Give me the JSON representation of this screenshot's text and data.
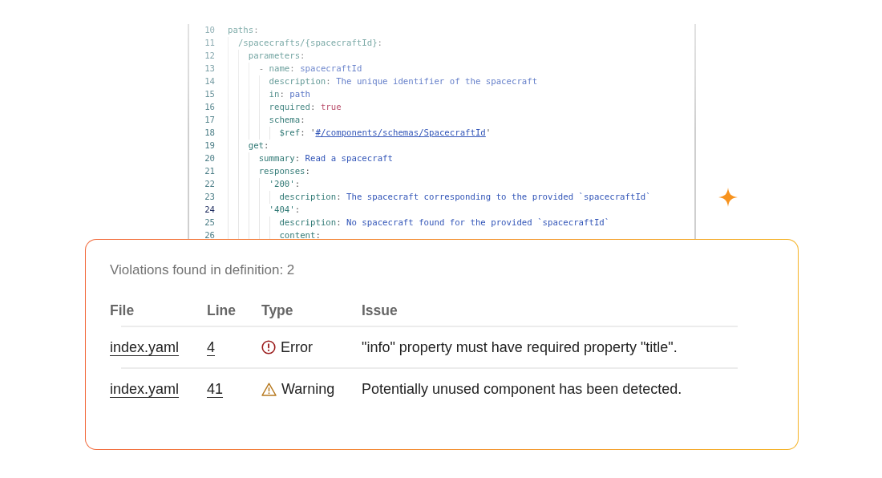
{
  "editor": {
    "lines": [
      {
        "number": "10",
        "selected": false,
        "parts": [
          {
            "kind": "key",
            "text": "paths"
          },
          {
            "kind": "punct",
            "text": ":"
          }
        ],
        "children": [
          {
            "number": "11",
            "selected": false,
            "parts": [
              {
                "kind": "key",
                "text": "/spacecrafts/{spacecraftId}"
              },
              {
                "kind": "punct",
                "text": ":"
              }
            ],
            "children": [
              {
                "number": "12",
                "selected": false,
                "parts": [
                  {
                    "kind": "key",
                    "text": "parameters"
                  },
                  {
                    "kind": "punct",
                    "text": ":"
                  }
                ],
                "children": [
                  {
                    "number": "13",
                    "selected": false,
                    "parts": [
                      {
                        "kind": "punct",
                        "text": "- "
                      },
                      {
                        "kind": "key",
                        "text": "name"
                      },
                      {
                        "kind": "punct",
                        "text": ": "
                      },
                      {
                        "kind": "value",
                        "text": "spacecraftId"
                      }
                    ],
                    "children": [
                      {
                        "number": "14",
                        "selected": false,
                        "parts": [
                          {
                            "kind": "key",
                            "text": "description"
                          },
                          {
                            "kind": "punct",
                            "text": ": "
                          },
                          {
                            "kind": "value",
                            "text": "The unique identifier of the spacecraft"
                          }
                        ]
                      },
                      {
                        "number": "15",
                        "selected": false,
                        "parts": [
                          {
                            "kind": "key",
                            "text": "in"
                          },
                          {
                            "kind": "punct",
                            "text": ": "
                          },
                          {
                            "kind": "value",
                            "text": "path"
                          }
                        ]
                      },
                      {
                        "number": "16",
                        "selected": false,
                        "parts": [
                          {
                            "kind": "key",
                            "text": "required"
                          },
                          {
                            "kind": "punct",
                            "text": ": "
                          },
                          {
                            "kind": "bool",
                            "text": "true"
                          }
                        ]
                      },
                      {
                        "number": "17",
                        "selected": false,
                        "parts": [
                          {
                            "kind": "key",
                            "text": "schema"
                          },
                          {
                            "kind": "punct",
                            "text": ":"
                          }
                        ],
                        "children": [
                          {
                            "number": "18",
                            "selected": false,
                            "parts": [
                              {
                                "kind": "key",
                                "text": "$ref"
                              },
                              {
                                "kind": "punct",
                                "text": ": '"
                              },
                              {
                                "kind": "link",
                                "text": "#/components/schemas/SpacecraftId"
                              },
                              {
                                "kind": "punct",
                                "text": "'"
                              }
                            ]
                          }
                        ]
                      }
                    ]
                  }
                ]
              },
              {
                "number": "19",
                "selected": false,
                "parts": [
                  {
                    "kind": "key",
                    "text": "get"
                  },
                  {
                    "kind": "punct",
                    "text": ":"
                  }
                ],
                "children": [
                  {
                    "number": "20",
                    "selected": false,
                    "parts": [
                      {
                        "kind": "key",
                        "text": "summary"
                      },
                      {
                        "kind": "punct",
                        "text": ": "
                      },
                      {
                        "kind": "value",
                        "text": "Read a spacecraft"
                      }
                    ]
                  },
                  {
                    "number": "21",
                    "selected": false,
                    "parts": [
                      {
                        "kind": "key",
                        "text": "responses"
                      },
                      {
                        "kind": "punct",
                        "text": ":"
                      }
                    ],
                    "children": [
                      {
                        "number": "22",
                        "selected": false,
                        "parts": [
                          {
                            "kind": "key",
                            "text": "'200'"
                          },
                          {
                            "kind": "punct",
                            "text": ":"
                          }
                        ],
                        "children": [
                          {
                            "number": "23",
                            "selected": false,
                            "parts": [
                              {
                                "kind": "key",
                                "text": "description"
                              },
                              {
                                "kind": "punct",
                                "text": ": "
                              },
                              {
                                "kind": "value",
                                "text": "The spacecraft corresponding to the provided `spacecraftId`"
                              }
                            ]
                          }
                        ]
                      },
                      {
                        "number": "24",
                        "selected": true,
                        "parts": [
                          {
                            "kind": "key",
                            "text": "'404'"
                          },
                          {
                            "kind": "punct",
                            "text": ":"
                          }
                        ],
                        "children": [
                          {
                            "number": "25",
                            "selected": false,
                            "parts": [
                              {
                                "kind": "key",
                                "text": "description"
                              },
                              {
                                "kind": "punct",
                                "text": ": "
                              },
                              {
                                "kind": "value",
                                "text": "No spacecraft found for the provided `spacecraftId`"
                              }
                            ]
                          },
                          {
                            "number": "26",
                            "selected": false,
                            "parts": [
                              {
                                "kind": "key",
                                "text": "content"
                              },
                              {
                                "kind": "punct",
                                "text": ":"
                              }
                            ]
                          }
                        ]
                      }
                    ]
                  }
                ]
              }
            ]
          }
        ]
      }
    ]
  },
  "report": {
    "title": "Violations found in definition: 2",
    "columns": [
      "File",
      "Line",
      "Type",
      "Issue"
    ],
    "rows": [
      {
        "file": "index.yaml",
        "line": "4",
        "type": "Error",
        "kind": "error",
        "issue": "\"info\" property must have required property \"title\"."
      },
      {
        "file": "index.yaml",
        "line": "41",
        "type": "Warning",
        "kind": "warning",
        "issue": "Potentially unused component has been detected."
      }
    ]
  }
}
